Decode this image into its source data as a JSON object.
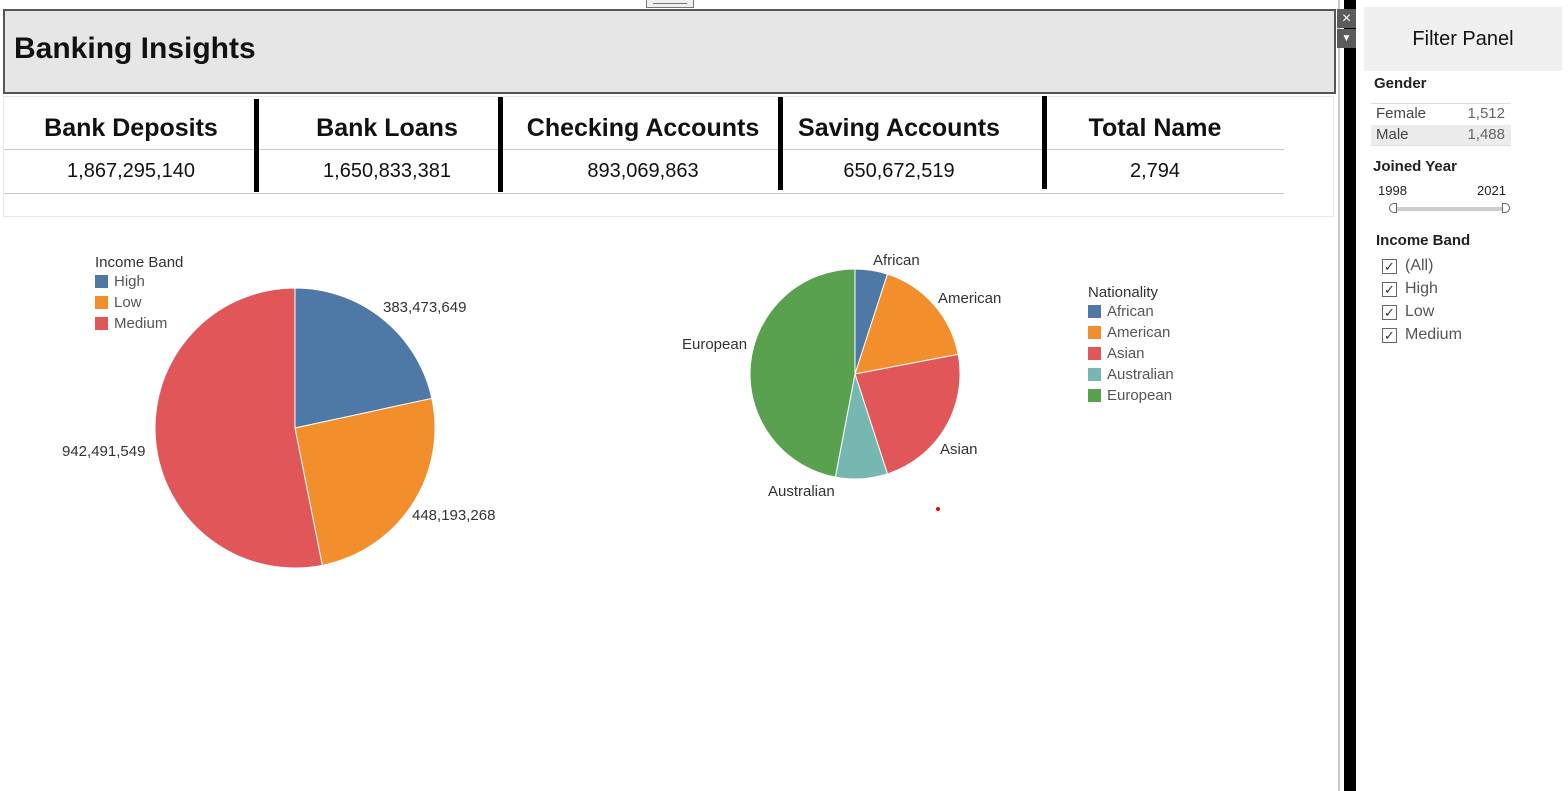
{
  "dashboard": {
    "title": "Banking Insights"
  },
  "kpis": [
    {
      "title": "Bank Deposits",
      "value": "1,867,295,140"
    },
    {
      "title": "Bank Loans",
      "value": "1,650,833,381"
    },
    {
      "title": "Checking Accounts",
      "value": "893,069,863"
    },
    {
      "title": "Saving Accounts",
      "value": "650,672,519"
    },
    {
      "title": "Total Name",
      "value": "2,794"
    }
  ],
  "filter_panel": {
    "title": "Filter Panel",
    "gender": {
      "label": "Gender",
      "rows": [
        {
          "name": "Female",
          "count": "1,512"
        },
        {
          "name": "Male",
          "count": "1,488"
        }
      ]
    },
    "joined_year": {
      "label": "Joined Year",
      "min": "1998",
      "max": "2021"
    },
    "income_band": {
      "label": "Income Band",
      "options": [
        {
          "label": "(All)",
          "checked": true
        },
        {
          "label": "High",
          "checked": true
        },
        {
          "label": "Low",
          "checked": true
        },
        {
          "label": "Medium",
          "checked": true
        }
      ]
    }
  },
  "colors": {
    "blue": "#4e79a7",
    "orange": "#f28e2b",
    "red": "#e15759",
    "teal": "#76b7b2",
    "green": "#59a14f"
  },
  "chart_data": [
    {
      "type": "pie",
      "legend_title": "Income Band",
      "categories": [
        "High",
        "Low",
        "Medium"
      ],
      "values": [
        383473649,
        448193268,
        942491549
      ],
      "labels": [
        "383,473,649",
        "448,193,268",
        "942,491,549"
      ],
      "colors": [
        "#4e79a7",
        "#f28e2b",
        "#e15759"
      ]
    },
    {
      "type": "pie",
      "legend_title": "Nationality",
      "categories": [
        "African",
        "American",
        "Asian",
        "Australian",
        "European"
      ],
      "values": [
        5,
        17,
        23,
        8,
        47
      ],
      "colors": [
        "#4e79a7",
        "#f28e2b",
        "#e15759",
        "#76b7b2",
        "#59a14f"
      ]
    }
  ]
}
